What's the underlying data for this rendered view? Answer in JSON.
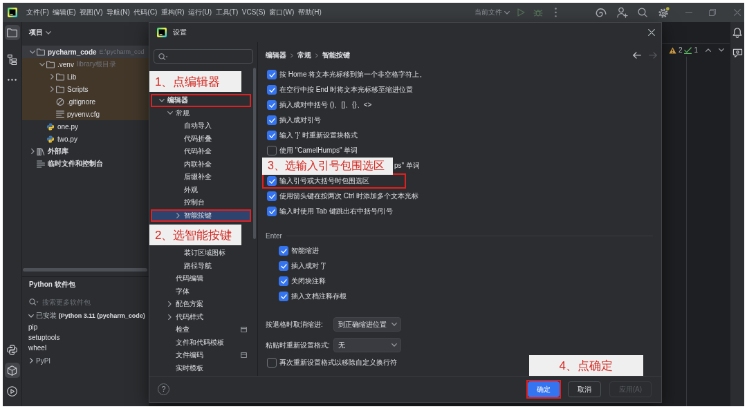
{
  "title_bar": {
    "menu": [
      "文件(F)",
      "编辑(E)",
      "视图(V)",
      "导航(N)",
      "代码(C)",
      "重构(R)",
      "运行(U)",
      "工具(T)",
      "VCS(S)",
      "窗口(W)",
      "帮助(H)"
    ],
    "run_config": "当前文件"
  },
  "tool_strip": {
    "top": [
      {
        "kind": "folder",
        "selected": true
      },
      {
        "kind": "hierarchy",
        "selected": false
      },
      {
        "kind": "dots",
        "selected": false
      }
    ],
    "bottom": [
      {
        "kind": "python",
        "selected": false
      },
      {
        "kind": "package",
        "selected": true
      },
      {
        "kind": "play",
        "selected": false
      }
    ]
  },
  "project_panel": {
    "title": "项目",
    "tree": [
      {
        "kind": "folder",
        "label": "pycharm_code",
        "hint": "E:\\pycharm_cod",
        "expanded": true,
        "selected": true,
        "highlighted": false,
        "children": [
          {
            "kind": "folder",
            "label": ".venv",
            "hint": "library根目录",
            "expanded": true,
            "selected": false,
            "highlighted": true,
            "children": [
              {
                "kind": "folder",
                "label": "Lib",
                "expanded": false,
                "selected": false,
                "highlighted": true
              },
              {
                "kind": "folder",
                "label": "Scripts",
                "expanded": false,
                "selected": false,
                "highlighted": true
              },
              {
                "kind": "ignore",
                "label": ".gitignore",
                "selected": false,
                "highlighted": true
              },
              {
                "kind": "config",
                "label": "pyvenv.cfg",
                "selected": false,
                "highlighted": true
              }
            ]
          },
          {
            "kind": "python",
            "label": "one.py",
            "selected": false,
            "highlighted": false
          },
          {
            "kind": "python",
            "label": "two.py",
            "selected": false,
            "highlighted": false
          }
        ]
      },
      {
        "kind": "library",
        "label": "外部库",
        "expanded": false,
        "selected": false,
        "highlighted": false
      },
      {
        "kind": "scratch",
        "label": "临时文件和控制台",
        "selected": false,
        "highlighted": false
      }
    ]
  },
  "packages_panel": {
    "title": "Python 软件包",
    "search": {
      "placeholder": "搜索更多软件包"
    },
    "groups": [
      {
        "label": "已安装 **(Python 3.11 (pycharm_code)**",
        "expanded": true,
        "packages": [
          "pip",
          "setuptools",
          "wheel"
        ]
      },
      {
        "label": "PyPI",
        "expanded": false
      }
    ]
  },
  "editor": {
    "inspections": {
      "warnings": "2",
      "passed": "1"
    }
  },
  "settings_dialog": {
    "title": "设置",
    "tree": [
      {
        "label": "编辑器",
        "expanded": true,
        "selected": false,
        "marked": true,
        "callout": "1、点编辑器",
        "children": [
          {
            "label": "常规",
            "expanded": true,
            "selected": false,
            "children": [
              {
                "label": "自动导入",
                "selected": false
              },
              {
                "label": "代码折叠",
                "selected": false
              },
              {
                "label": "代码补全",
                "selected": false
              },
              {
                "label": "内联补全",
                "selected": false
              },
              {
                "label": "后缀补全",
                "selected": false
              },
              {
                "label": "外观",
                "selected": false
              },
              {
                "label": "控制台",
                "selected": false
              },
              {
                "label": "智能按键",
                "expanded": false,
                "selected": true,
                "marked": true,
                "callout": "2、选智能按键"
              },
              {
                "label": "装订区域图标",
                "selected": false
              },
              {
                "label": "路径导航",
                "selected": false
              }
            ]
          },
          {
            "label": "代码编辑",
            "selected": false
          },
          {
            "label": "字体",
            "selected": false
          },
          {
            "label": "配色方案",
            "expanded": false,
            "selected": false
          },
          {
            "label": "代码样式",
            "expanded": false,
            "selected": false
          },
          {
            "label": "检查",
            "selected": false,
            "badge_icon": true
          },
          {
            "label": "文件和代码模板",
            "selected": false
          },
          {
            "label": "文件编码",
            "selected": false,
            "badge_icon": true
          },
          {
            "label": "实时模板",
            "selected": false
          }
        ]
      }
    ],
    "breadcrumb": [
      "编辑器",
      "常规",
      "智能按键"
    ],
    "history": [
      {
        "kind": "back",
        "disabled": false
      },
      {
        "kind": "forward",
        "disabled": true
      }
    ],
    "options": [
      {
        "kind": "checkbox",
        "label": "按 Home 将文本光标移到第一个非空格字符上。",
        "checked": true
      },
      {
        "kind": "checkbox",
        "label": "在空行中按 End 时将文本光标移至缩进位置",
        "checked": true
      },
      {
        "kind": "checkbox",
        "label": "插入成对中括号 ()、[]、{}、<>",
        "checked": true
      },
      {
        "kind": "checkbox",
        "label": "插入成对引号",
        "checked": true
      },
      {
        "kind": "checkbox",
        "label": "输入 '}' 时重新设置块格式",
        "checked": true
      },
      {
        "kind": "checkbox",
        "label": "使用 \"CamelHumps\" 单词",
        "checked": false
      },
      {
        "kind": "covered",
        "label": "ps\" 单词"
      },
      {
        "kind": "checkbox",
        "label": "输入引号或大括号时包围选区",
        "checked": true,
        "marked": true,
        "callout": "3、选输入引号包围选区"
      },
      {
        "kind": "checkbox",
        "label": "使用箭头键在按两次 Ctrl 时添加多个文本光标",
        "checked": true
      },
      {
        "kind": "checkbox",
        "label": "输入时使用 Tab 键跳出右中括号/引号",
        "checked": true
      }
    ],
    "enter_section": {
      "title": "Enter",
      "options": [
        {
          "label": "智能缩进",
          "checked": true
        },
        {
          "label": "插入成对 '}'",
          "checked": true
        },
        {
          "label": "关闭块注释",
          "checked": true
        },
        {
          "label": "插入文档注释存根",
          "checked": true
        }
      ]
    },
    "selects": [
      {
        "label": "按退格时取消缩进:",
        "value": "到正确缩进位置"
      },
      {
        "label": "粘贴时重新设置格式:",
        "value": "无"
      }
    ],
    "final_options": [
      {
        "label": "再次重新设置格式以移除自定义换行符",
        "checked": false
      }
    ],
    "help": "?",
    "buttons": [
      {
        "label": "确定",
        "kind": "primary",
        "disabled": false,
        "marked": true,
        "callout": "4、点确定"
      },
      {
        "label": "取消",
        "kind": "secondary",
        "disabled": false
      },
      {
        "label": "应用(A)",
        "kind": "secondary",
        "disabled": true
      }
    ]
  }
}
